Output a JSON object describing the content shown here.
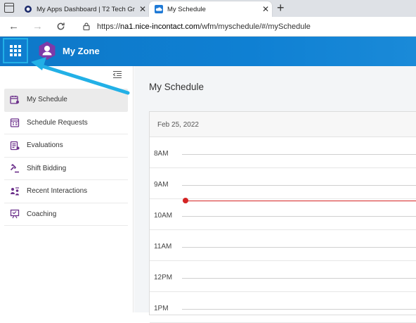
{
  "browser": {
    "tabs": [
      {
        "title": "My Apps Dashboard | T2 Tech Gr",
        "close": "✕",
        "active": false
      },
      {
        "title": "My Schedule",
        "close": "✕",
        "active": true
      }
    ],
    "new_tab": "+",
    "url_prefix": "https://",
    "url_host": "na1.nice-incontact.com",
    "url_path": "/wfm/myschedule/#/mySchedule"
  },
  "header": {
    "app_title": "My Zone",
    "accent": "#0f80d3",
    "highlight": "#22b0e6"
  },
  "sidebar": {
    "items": [
      {
        "label": "My Schedule",
        "icon": "calendar-person-icon",
        "active": true
      },
      {
        "label": "Schedule Requests",
        "icon": "calendar-list-icon",
        "active": false
      },
      {
        "label": "Evaluations",
        "icon": "evaluation-icon",
        "active": false
      },
      {
        "label": "Shift Bidding",
        "icon": "gavel-icon",
        "active": false
      },
      {
        "label": "Recent Interactions",
        "icon": "people-interaction-icon",
        "active": false
      },
      {
        "label": "Coaching",
        "icon": "coaching-icon",
        "active": false
      }
    ],
    "icon_color": "#6b2f8a"
  },
  "main": {
    "page_title": "My Schedule",
    "date": "Feb 25, 2022",
    "hours": [
      "8AM",
      "9AM",
      "10AM",
      "11AM",
      "12PM",
      "1PM"
    ],
    "current_time_color": "#d42424"
  }
}
